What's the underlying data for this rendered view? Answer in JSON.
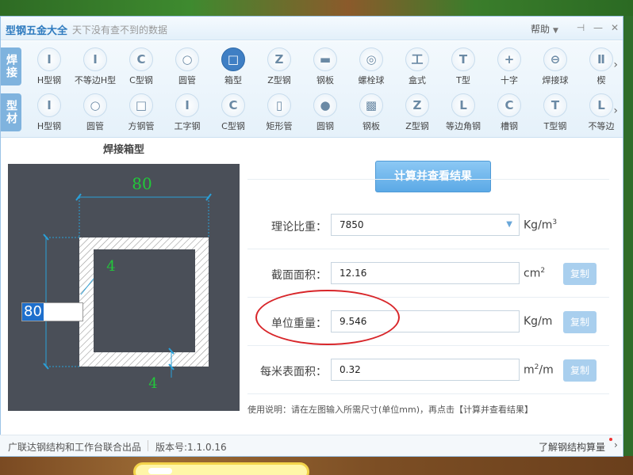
{
  "window": {
    "app_name": "型钢五金大全",
    "slogan": "天下没有查不到的数据",
    "help": "帮助"
  },
  "toolbar": {
    "weld_category": "焊接",
    "profile_category": "型材",
    "weld_items": [
      {
        "label": "H型钢",
        "glyph": "I"
      },
      {
        "label": "不等边H型",
        "glyph": "I"
      },
      {
        "label": "C型钢",
        "glyph": "C"
      },
      {
        "label": "圆管",
        "glyph": "○"
      },
      {
        "label": "箱型",
        "glyph": "□"
      },
      {
        "label": "Z型钢",
        "glyph": "Z"
      },
      {
        "label": "钢板",
        "glyph": "▬"
      },
      {
        "label": "螺栓球",
        "glyph": "◎"
      },
      {
        "label": "盒式",
        "glyph": "工"
      },
      {
        "label": "T型",
        "glyph": "T"
      },
      {
        "label": "十字",
        "glyph": "+"
      },
      {
        "label": "焊接球",
        "glyph": "⊖"
      },
      {
        "label": "楔",
        "glyph": "Ⅱ"
      }
    ],
    "profile_items": [
      {
        "label": "H型钢",
        "glyph": "I"
      },
      {
        "label": "圆管",
        "glyph": "○"
      },
      {
        "label": "方钢管",
        "glyph": "□"
      },
      {
        "label": "工字钢",
        "glyph": "I"
      },
      {
        "label": "C型钢",
        "glyph": "C"
      },
      {
        "label": "矩形管",
        "glyph": "▯"
      },
      {
        "label": "圆钢",
        "glyph": "●"
      },
      {
        "label": "钢板",
        "glyph": "▩"
      },
      {
        "label": "Z型钢",
        "glyph": "Z"
      },
      {
        "label": "等边角钢",
        "glyph": "L"
      },
      {
        "label": "槽钢",
        "glyph": "C"
      },
      {
        "label": "T型钢",
        "glyph": "T"
      },
      {
        "label": "不等边",
        "glyph": "L"
      }
    ]
  },
  "panel": {
    "title": "焊接箱型",
    "dim_top": "80",
    "dim_thickness_top": "4",
    "dim_thickness_bottom": "4",
    "dim_left_input": "80"
  },
  "form": {
    "calc_button": "计算并查看结果",
    "density_label": "理论比重：",
    "density_value": "7850",
    "density_unit": "Kg/m",
    "density_unit_sup": "3",
    "area_label": "截面面积：",
    "area_value": "12.16",
    "area_unit": "cm",
    "area_unit_sup": "2",
    "weight_label": "单位重量：",
    "weight_value": "9.546",
    "weight_unit": "Kg/m",
    "surface_label": "每米表面积：",
    "surface_value": "0.32",
    "surface_unit": "/m",
    "surface_unit_prefix": "m",
    "surface_unit_sup": "2",
    "copy": "复制",
    "note": "使用说明：请在左图输入所需尺寸(单位mm)，再点击【计算并查看结果】"
  },
  "status": {
    "left": "广联达钢结构和工作台联合出品",
    "version": "版本号:1.1.0.16",
    "right": "了解钢结构算量"
  },
  "colors": {
    "accent": "#3f7fc4",
    "annotation": "#d8262a",
    "dimension_text": "#22c83a",
    "diagram_bg": "#4a4f58"
  }
}
